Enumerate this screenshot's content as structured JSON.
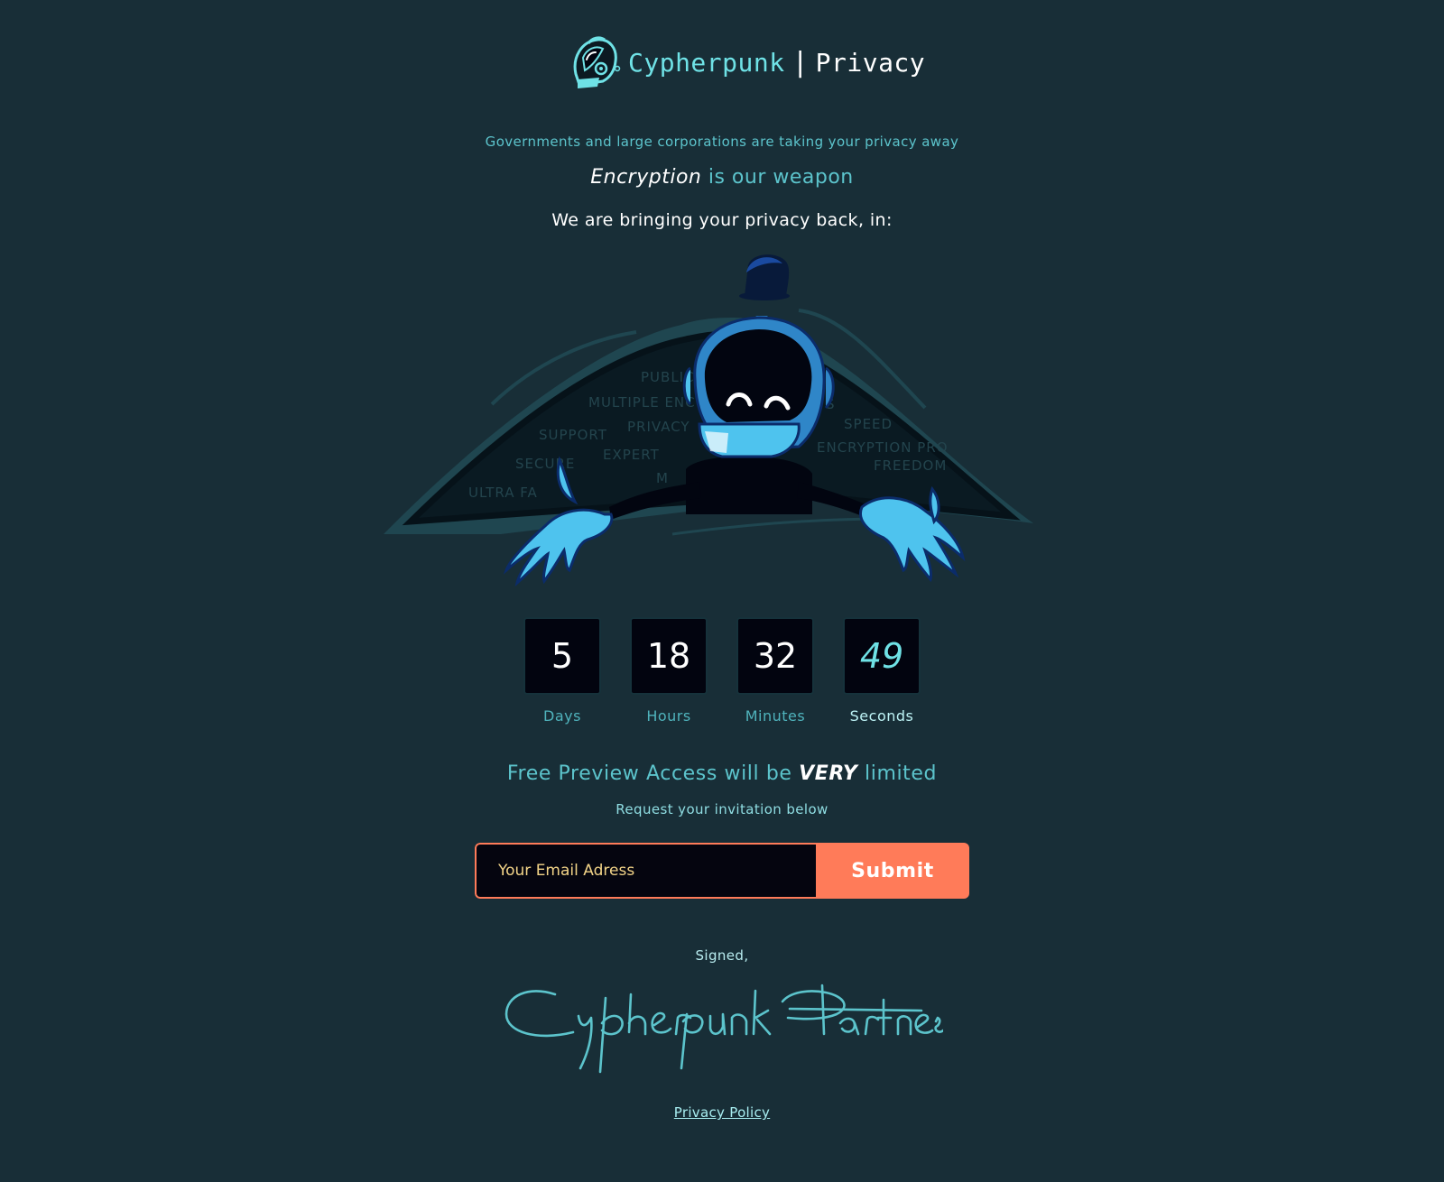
{
  "brand": {
    "logo_icon": "cypherpunk-helmet-logo-icon",
    "name_primary": "Cypherpunk",
    "separator": "|",
    "name_secondary": "Privacy"
  },
  "tagline": "Governments and large corporations are taking your privacy away",
  "headline": {
    "emphasis": "Encryption",
    "rest": " is our weapon"
  },
  "bringing_back": "We are bringing your privacy back, in:",
  "hero": {
    "illustration": "cypherpunk-mascot-peeking-from-cloak",
    "background_words": [
      "PUBLIC",
      "MULTIPLE ENC",
      "S",
      "PRIVACY",
      "SUPPORT",
      "SPEED",
      "EXPERT",
      "ENCRYPTION PRO",
      "SECURE",
      "FREEDOM",
      "M",
      "ULTRA FA"
    ]
  },
  "countdown": {
    "days": {
      "value": "5",
      "label": "Days"
    },
    "hours": {
      "value": "18",
      "label": "Hours"
    },
    "minutes": {
      "value": "32",
      "label": "Minutes"
    },
    "seconds": {
      "value": "49",
      "label": "Seconds"
    }
  },
  "offer": {
    "before": "Free Preview Access will be ",
    "emphasis": "VERY",
    "after": " limited"
  },
  "request": "Request your invitation below",
  "form": {
    "email_placeholder": "Your Email Adress",
    "email_value": "",
    "submit_label": "Submit"
  },
  "signed": "Signed,",
  "signature": "Cypherpunk Partners",
  "footer": {
    "privacy_policy": "Privacy Policy"
  },
  "colors": {
    "background": "#182e37",
    "accent": "#5cc4cc",
    "cta": "#ff7b59",
    "box": "#02040f"
  }
}
